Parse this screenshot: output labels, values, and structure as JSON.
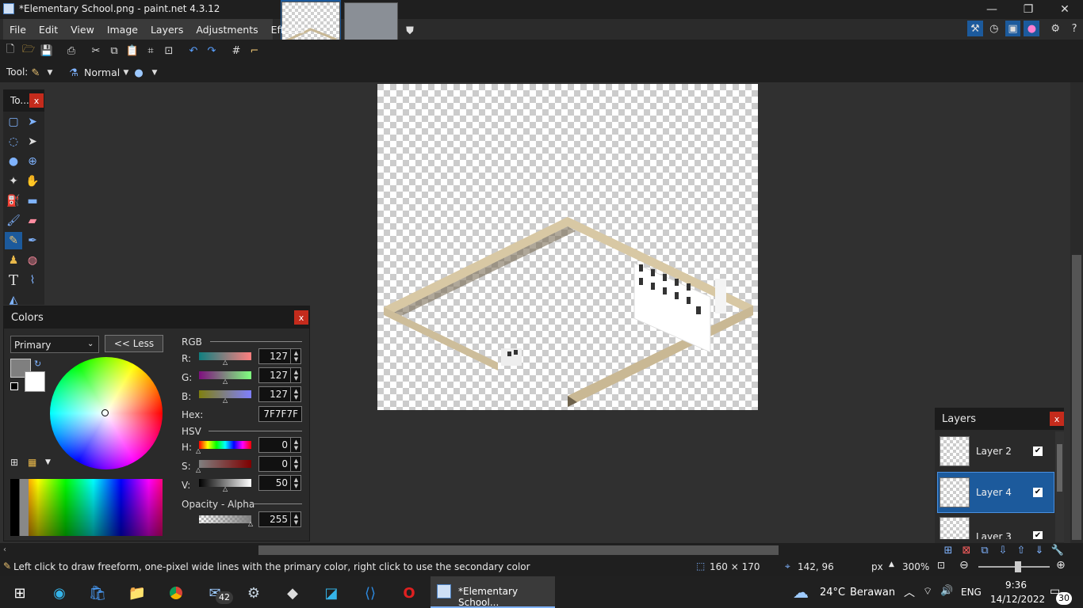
{
  "window": {
    "title": "*Elementary School.png - paint.net 4.3.12"
  },
  "menu": [
    "File",
    "Edit",
    "View",
    "Image",
    "Layers",
    "Adjustments",
    "Effects"
  ],
  "toolbar": {
    "tool_label": "Tool:",
    "blend_mode": "Normal"
  },
  "tools_panel": {
    "title": "To..."
  },
  "colors_panel": {
    "title": "Colors",
    "color_select": "Primary",
    "less_button": "<< Less",
    "rgb_header": "RGB",
    "r_label": "R:",
    "g_label": "G:",
    "b_label": "B:",
    "r_value": "127",
    "g_value": "127",
    "b_value": "127",
    "hex_label": "Hex:",
    "hex_value": "7F7F7F",
    "hsv_header": "HSV",
    "h_label": "H:",
    "s_label": "S:",
    "v_label": "V:",
    "h_value": "0",
    "s_value": "0",
    "v_value": "50",
    "opacity_header": "Opacity - Alpha",
    "alpha_value": "255",
    "primary_color": "#7f7f7f",
    "secondary_color": "#ffffff"
  },
  "layers_panel": {
    "title": "Layers",
    "layers": [
      {
        "name": "Layer 2",
        "visible": true,
        "selected": false
      },
      {
        "name": "Layer 4",
        "visible": true,
        "selected": true
      },
      {
        "name": "Layer 3",
        "visible": true,
        "selected": false
      }
    ]
  },
  "status": {
    "hint": "Left click to draw freeform, one-pixel wide lines with the primary color, right click to use the secondary color",
    "selection_size": "160 × 170",
    "cursor_pos": "142, 96",
    "units": "px",
    "zoom": "300%"
  },
  "taskbar": {
    "active_app": "*Elementary School...",
    "mail_badge": "42",
    "weather_temp": "24°C",
    "weather_text": "Berawan",
    "language": "ENG",
    "time": "9:36",
    "date": "14/12/2022",
    "notification_count": "30"
  },
  "colors": {
    "accent": "#1c5a9c",
    "close_red": "#c42b1c"
  }
}
